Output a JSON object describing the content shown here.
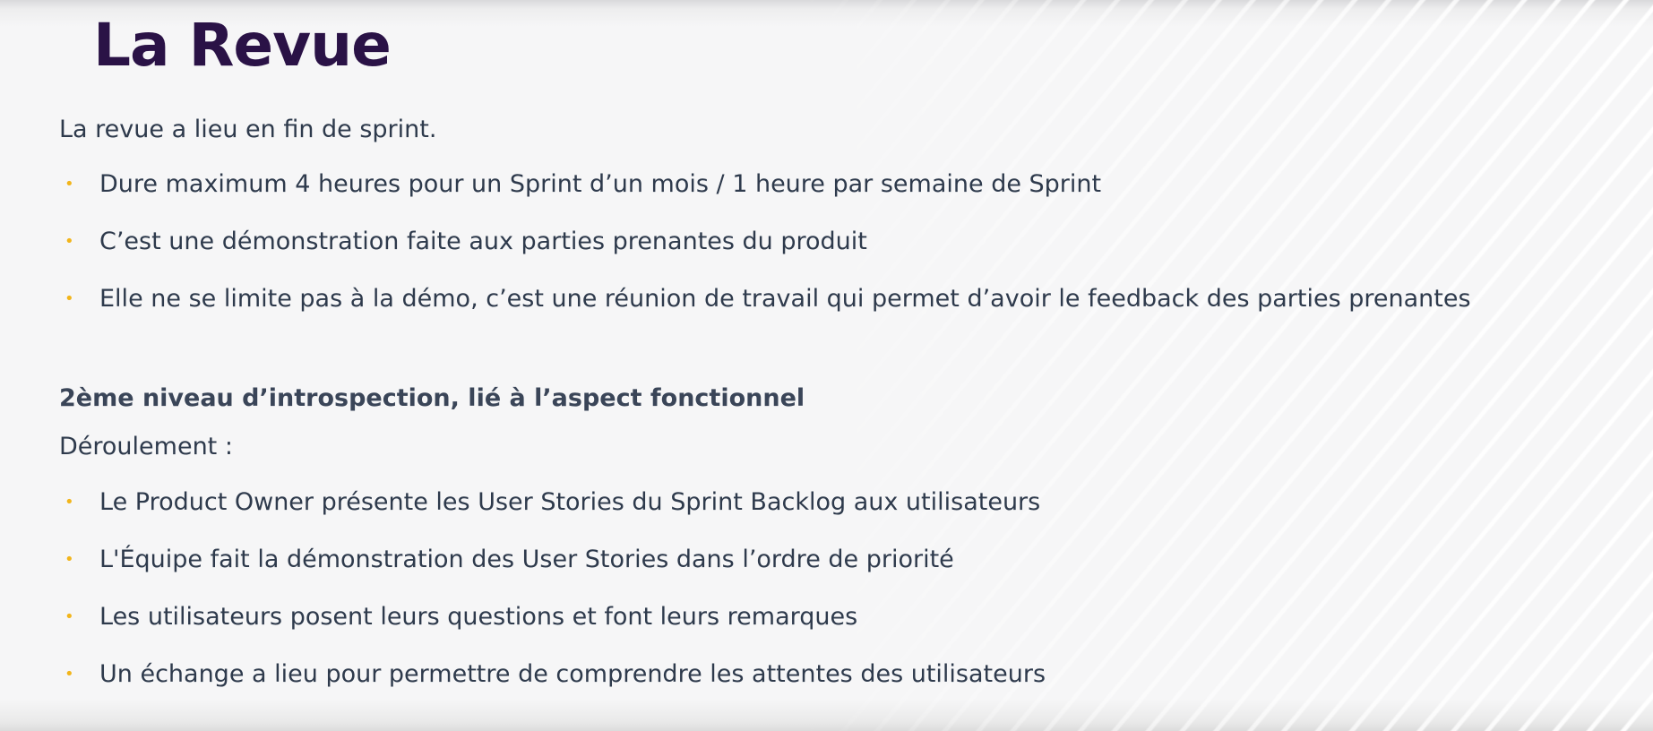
{
  "slide": {
    "title": "La Revue",
    "intro": "La revue a lieu en fin de sprint.",
    "bullets_first": [
      "Dure maximum 4 heures pour un Sprint d’un mois  / 1 heure par semaine de Sprint",
      "C’est une démonstration faite aux parties prenantes du produit",
      "Elle ne se limite pas à la démo,  c’est une réunion de travail qui permet d’avoir le feedback des  parties prenantes"
    ],
    "heading": "2ème niveau d’introspection, lié à l’aspect fonctionnel",
    "step_label": "Déroulement :",
    "bullets_second": [
      "Le Product Owner présente les User Stories du Sprint Backlog aux utilisateurs",
      "L'Équipe fait la démonstration des User Stories dans l’ordre de priorité",
      "Les utilisateurs posent leurs questions et font leurs remarques",
      "Un échange a lieu pour permettre de comprendre les attentes des utilisateurs"
    ],
    "bullet_symbol": "•"
  },
  "colors": {
    "title": "#2a1246",
    "body_text": "#2e3a4c",
    "bullet": "#f2b51b",
    "background": "#f6f6f7"
  }
}
